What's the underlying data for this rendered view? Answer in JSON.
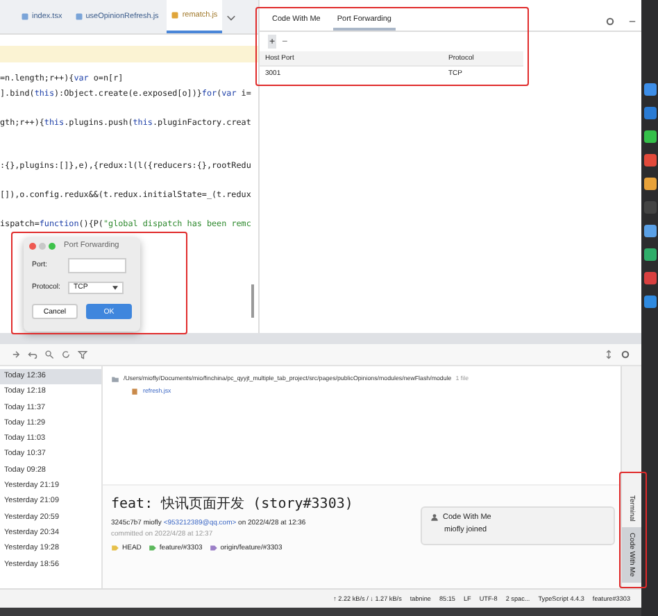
{
  "editor_tabs": [
    {
      "label": "index.tsx",
      "selected": false
    },
    {
      "label": "useOpinionRefresh.js",
      "selected": false
    },
    {
      "label": "rematch.js",
      "selected": true
    }
  ],
  "code_lines": [
    {
      "kind": "code",
      "segments": [
        {
          "text": "=n.length;r++){",
          "kind": "plain"
        },
        {
          "text": "var",
          "kind": "keyword"
        },
        {
          "text": " o=n[r]",
          "kind": "plain"
        }
      ]
    },
    {
      "kind": "code",
      "segments": [
        {
          "text": "].bind(",
          "kind": "plain"
        },
        {
          "text": "this",
          "kind": "keyword"
        },
        {
          "text": "):Object.create(e.exposed[o])}",
          "kind": "plain"
        },
        {
          "text": "for",
          "kind": "keyword"
        },
        {
          "text": "(",
          "kind": "plain"
        },
        {
          "text": "var",
          "kind": "keyword"
        },
        {
          "text": " i=",
          "kind": "plain"
        }
      ]
    },
    {
      "kind": "blank"
    },
    {
      "kind": "code",
      "segments": [
        {
          "text": "gth;r++){",
          "kind": "plain"
        },
        {
          "text": "this",
          "kind": "keyword"
        },
        {
          "text": ".plugins.push(",
          "kind": "plain"
        },
        {
          "text": "this",
          "kind": "keyword"
        },
        {
          "text": ".pluginFactory.creat",
          "kind": "plain"
        }
      ]
    },
    {
      "kind": "blank"
    },
    {
      "kind": "blank"
    },
    {
      "kind": "code",
      "segments": [
        {
          "text": ":{},plugins:[]},e),{redux:l(l({reducers:{},rootRedu",
          "kind": "plain"
        }
      ]
    },
    {
      "kind": "blank"
    },
    {
      "kind": "code",
      "segments": [
        {
          "text": "[]),o.config.redux&&(t.redux.initialState=_(t.redux",
          "kind": "plain"
        }
      ]
    },
    {
      "kind": "blank"
    },
    {
      "kind": "code",
      "segments": [
        {
          "text": "ispatch=",
          "kind": "plain"
        },
        {
          "text": "function",
          "kind": "keyword"
        },
        {
          "text": "(){P(",
          "kind": "plain"
        },
        {
          "text": "\"global dispatch has been remc",
          "kind": "string"
        }
      ]
    }
  ],
  "right_panel": {
    "tabs": [
      {
        "label": "Code With Me",
        "selected": false
      },
      {
        "label": "Port Forwarding",
        "selected": true
      }
    ],
    "toolbar": [
      "+",
      "−"
    ],
    "columns": [
      "Host Port",
      "Protocol"
    ],
    "rows": [
      [
        "3001",
        "TCP"
      ]
    ]
  },
  "dialog": {
    "title": "Port Forwarding",
    "fields": [
      {
        "label": "Port:",
        "kind": "input"
      },
      {
        "label": "Protocol:",
        "kind": "select",
        "value": "TCP"
      }
    ],
    "buttons": [
      {
        "label": "Cancel",
        "primary": false
      },
      {
        "label": "OK",
        "primary": true
      }
    ]
  },
  "commits": [
    {
      "time": "Today 12:36",
      "selected": true
    },
    {
      "time": "Today 12:18",
      "selected": false
    },
    {
      "time": "Today 11:37",
      "selected": false
    },
    {
      "time": "Today 11:29",
      "selected": false
    },
    {
      "time": "Today 11:03",
      "selected": false
    },
    {
      "time": "Today 10:37",
      "selected": false
    },
    {
      "time": "Today 09:28",
      "selected": false
    },
    {
      "time": "Yesterday 21:19",
      "selected": false
    },
    {
      "time": "Yesterday 21:09",
      "selected": false
    },
    {
      "time": "Yesterday 20:59",
      "selected": false
    },
    {
      "time": "Yesterday 20:34",
      "selected": false
    },
    {
      "time": "Yesterday 19:28",
      "selected": false
    },
    {
      "time": "Yesterday 18:56",
      "selected": false
    }
  ],
  "changes": {
    "path": "/Users/miofly/Documents/mio/finchina/pc_qyyjt_multiple_tab_project/src/pages/publicOpinions/modules/newFlash/module",
    "count": "1 file",
    "files": [
      "refresh.jsx"
    ]
  },
  "commit_details": {
    "message": "feat: 快讯页面开发 (story#3303)",
    "author": "3245c7b7 miofly",
    "email": "<953212389@qq.com>",
    "date": "on 2022/4/28 at 12:36",
    "committed": "committed on 2022/4/28 at 12:37",
    "refs": [
      "HEAD",
      "feature/#3303",
      "origin/feature/#3303"
    ]
  },
  "notification": {
    "title": "Code With Me",
    "body": "miofly joined"
  },
  "tool_strip": [
    {
      "label": "Terminal",
      "selected": false
    },
    {
      "label": "Code With Me",
      "selected": true
    }
  ],
  "status_bar": [
    "↑ 2.22 kB/s / ↓ 1.27 kB/s",
    "tabnine",
    "85:15",
    "LF",
    "UTF-8",
    "2 spac...",
    "TypeScript 4.4.3",
    "feature#3303"
  ]
}
